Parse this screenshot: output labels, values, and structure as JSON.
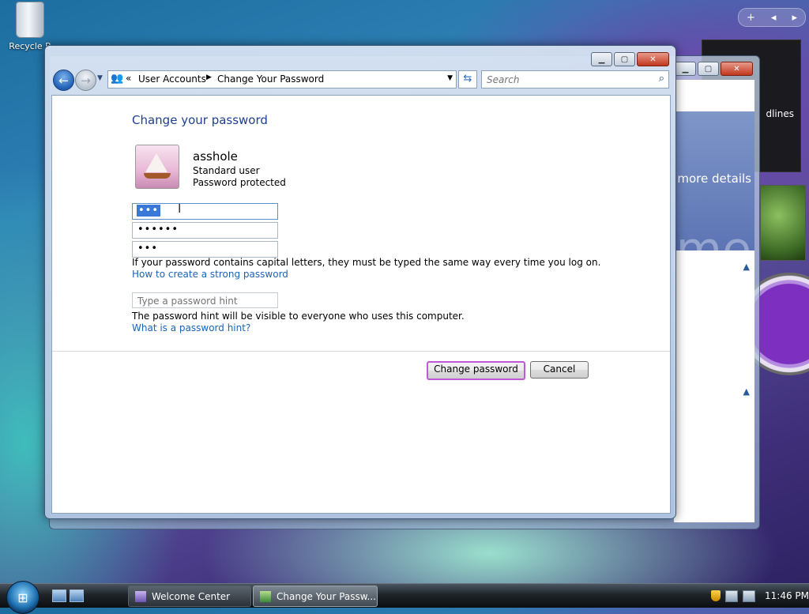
{
  "desktop": {
    "recycle_bin_label": "Recycle B",
    "gadget_headlines_label": "dlines"
  },
  "background_window": {
    "more_details_text": "more details",
    "welcome_fragment": "me"
  },
  "window": {
    "nav": {
      "address_crumbs": [
        "User Accounts",
        "Change Your Password"
      ],
      "search_placeholder": "Search"
    },
    "content": {
      "heading": "Change your password",
      "user": {
        "name": "asshole",
        "type": "Standard user",
        "status": "Password protected"
      },
      "fields": {
        "current_password_mask": "•••",
        "new_password_mask": "••••••",
        "confirm_password_mask": "•••"
      },
      "caps_note": "If your password contains capital letters, they must be typed the same way every time you log on.",
      "strong_password_link": "How to create a strong password",
      "hint_placeholder": "Type a password hint",
      "hint_note": "The password hint will be visible to everyone who uses this computer.",
      "hint_link": "What is a password hint?",
      "buttons": {
        "change": "Change password",
        "cancel": "Cancel"
      }
    }
  },
  "taskbar": {
    "tasks": [
      "Welcome Center",
      "Change Your Passw..."
    ],
    "clock": "11:46 PM"
  },
  "icons": {
    "recycle_bin": "recycle-bin-icon",
    "back": "back-arrow-icon",
    "forward": "forward-arrow-icon",
    "user_accounts": "user-accounts-icon",
    "refresh": "refresh-icon",
    "search": "search-icon",
    "start": "windows-orb-icon"
  },
  "colors": {
    "heading_blue": "#1e3f8f",
    "link_blue": "#1b63b8",
    "primary_button_glow": "#c059d8",
    "selection_blue": "#3a79d7"
  }
}
